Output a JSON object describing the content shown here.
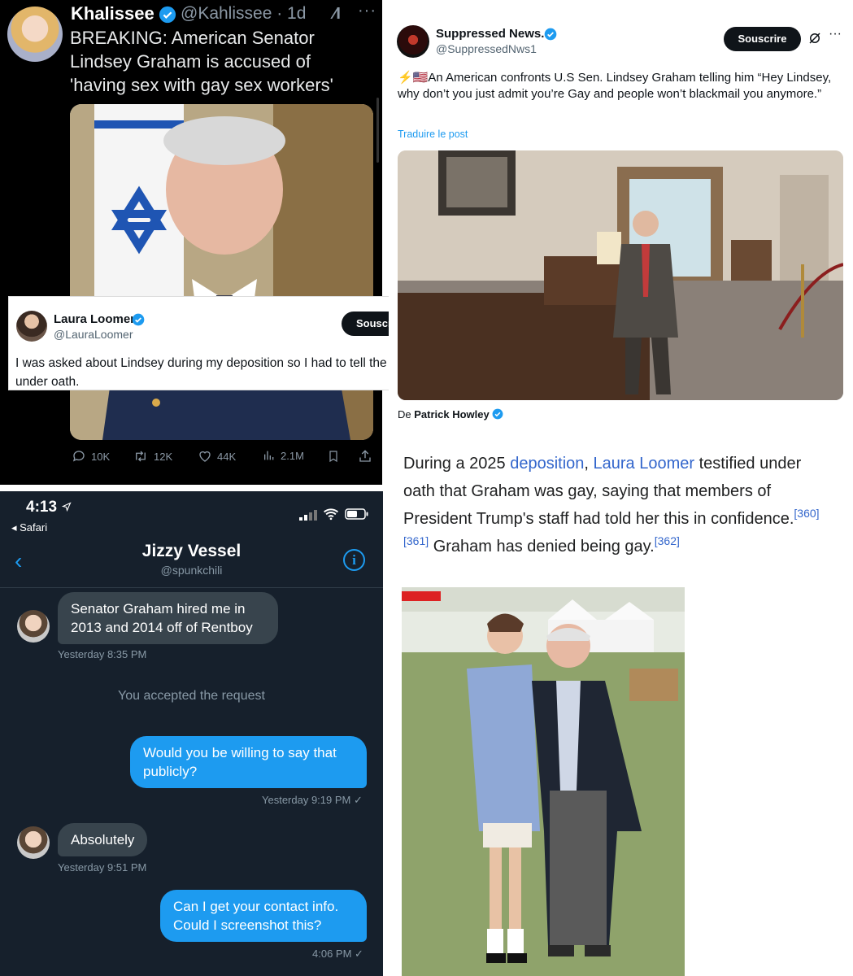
{
  "tweet_khalissee": {
    "name": "Khalissee",
    "handle": "@Kahlissee · 1d",
    "text": "BREAKING: American Senator Lindsey Graham is accused of 'having sex with gay sex workers'",
    "stats": {
      "replies": "10K",
      "retweets": "12K",
      "likes": "44K",
      "views": "2.1M"
    }
  },
  "tweet_loomer": {
    "name": "Laura Loomer",
    "handle": "@LauraLoomer",
    "subscribe_label": "Souscrire",
    "text": "I was asked about Lindsey during my deposition so I had to tell the truth. I was under oath."
  },
  "tweet_suppressed": {
    "name": "Suppressed News.",
    "handle": "@SuppressedNws1",
    "subscribe_label": "Souscrire",
    "text": "⚡🇺🇸An American confronts U.S Sen. Lindsey Graham telling him “Hey Lindsey, why don’t you just admit you’re Gay and people won’t blackmail you anymore.”",
    "translate_label": "Traduire le post",
    "credit_prefix": "De",
    "credit_name": "Patrick Howley"
  },
  "wiki": {
    "t1": "During a 2025 ",
    "link1": "deposition",
    "t2": ", ",
    "link2": "Laura Loomer",
    "t3": " testified under oath that Graham was gay, saying that members of President Trump's staff had told her this in confidence.",
    "ref1": "[360]",
    "ref2": "[361]",
    "t4": " Graham has denied being gay.",
    "ref3": "[362]"
  },
  "dm": {
    "status_time": "4:13",
    "back_app": "◂ Safari",
    "contact_name": "Jizzy Vessel",
    "contact_handle": "@spunkchili",
    "messages": [
      {
        "text": "Senator Graham hired me in 2013 and 2014 off of Rentboy",
        "time": "Yesterday 8:35 PM"
      },
      {
        "text": "You accepted the request"
      },
      {
        "text": "Would you be willing to say that publicly?",
        "time": "Yesterday 9:19 PM ✓"
      },
      {
        "text": "Absolutely",
        "time": "Yesterday 9:51 PM"
      },
      {
        "text": "Can I get your contact info. Could I screenshot this?",
        "time": "4:06 PM ✓"
      }
    ]
  },
  "colors": {
    "twitter_blue": "#1d9bf0",
    "wiki_link": "#3366cc",
    "dm_bg": "#16202c"
  }
}
